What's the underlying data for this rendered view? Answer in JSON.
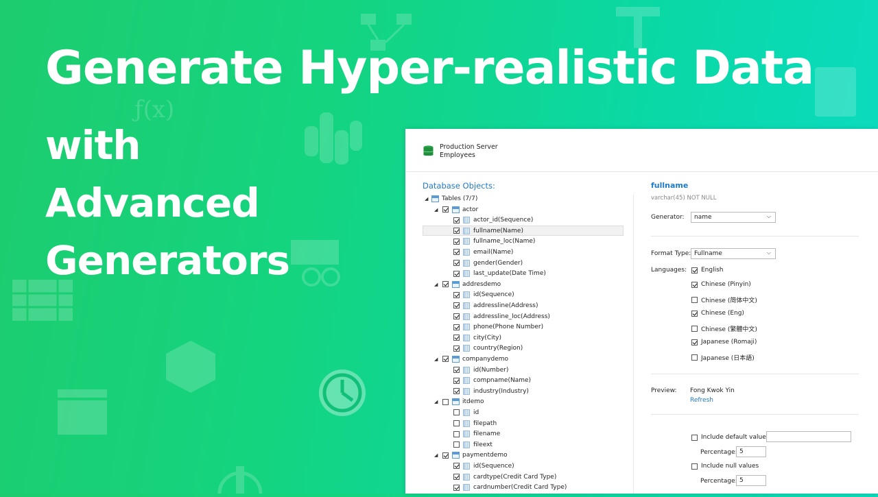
{
  "headline": {
    "line1": "Generate Hyper-realistic Data",
    "line2": "with",
    "line3": "Advanced",
    "line4": "Generators"
  },
  "server": {
    "name": "Production Server",
    "database": "Employees"
  },
  "objects": {
    "title": "Database Objects:",
    "root": "Tables (7/7)",
    "rows": [
      {
        "kind": "table",
        "label": "actor",
        "checked": true
      },
      {
        "kind": "col",
        "label": "actor_id(Sequence)",
        "checked": true
      },
      {
        "kind": "col",
        "label": "fullname(Name)",
        "checked": true,
        "selected": true
      },
      {
        "kind": "col",
        "label": "fullname_loc(Name)",
        "checked": true
      },
      {
        "kind": "col",
        "label": "email(Name)",
        "checked": true
      },
      {
        "kind": "col",
        "label": "gender(Gender)",
        "checked": true
      },
      {
        "kind": "col",
        "label": "last_update(Date Time)",
        "checked": true
      },
      {
        "kind": "table",
        "label": "addresdemo",
        "checked": true
      },
      {
        "kind": "col",
        "label": "id(Sequence)",
        "checked": true
      },
      {
        "kind": "col",
        "label": "addressline(Address)",
        "checked": true
      },
      {
        "kind": "col",
        "label": "addressline_loc(Address)",
        "checked": true
      },
      {
        "kind": "col",
        "label": "phone(Phone Number)",
        "checked": true
      },
      {
        "kind": "col",
        "label": "city(City)",
        "checked": true
      },
      {
        "kind": "col",
        "label": "country(Region)",
        "checked": true
      },
      {
        "kind": "table",
        "label": "companydemo",
        "checked": true
      },
      {
        "kind": "col",
        "label": "id(Number)",
        "checked": true
      },
      {
        "kind": "col",
        "label": "compname(Name)",
        "checked": true
      },
      {
        "kind": "col",
        "label": "industry(Industry)",
        "checked": true
      },
      {
        "kind": "table",
        "label": "itdemo",
        "checked": false
      },
      {
        "kind": "col",
        "label": "id",
        "checked": false
      },
      {
        "kind": "col",
        "label": "filepath",
        "checked": false
      },
      {
        "kind": "col",
        "label": "filename",
        "checked": false
      },
      {
        "kind": "col",
        "label": "fileext",
        "checked": false
      },
      {
        "kind": "table",
        "label": "paymentdemo",
        "checked": true
      },
      {
        "kind": "col",
        "label": "id(Sequence)",
        "checked": true
      },
      {
        "kind": "col",
        "label": "cardtype(Credit Card Type)",
        "checked": true
      },
      {
        "kind": "col",
        "label": "cardnumber(Credit Card Type)",
        "checked": true
      }
    ]
  },
  "field": {
    "name": "fullname",
    "type": "varchar(45) NOT NULL",
    "generator_label": "Generator:",
    "generator_value": "name",
    "format_label": "Format Type:",
    "format_value": "Fullname",
    "languages_label": "Languages:",
    "languages": [
      {
        "label": "English",
        "checked": true
      },
      {
        "label": "Chinese (Pinyin)",
        "checked": true
      },
      {
        "label": "Chinese (简体中文)",
        "checked": false
      },
      {
        "label": "Chinese (Eng)",
        "checked": true
      },
      {
        "label": "Chinese (繁體中文)",
        "checked": false
      },
      {
        "label": "Japanese (Romaji)",
        "checked": true
      },
      {
        "label": "Japanese (日本語)",
        "checked": false
      }
    ],
    "preview_label": "Preview:",
    "preview_value": "Fong Kwok Yin",
    "refresh": "Refresh",
    "include_default": "Include default values",
    "include_default_value": "",
    "percentage_label": "Percentage:",
    "default_percentage": "5",
    "include_null": "Include null values",
    "null_percentage": "5"
  },
  "colors": {
    "accent": "#1f7ac9",
    "bg_start": "#1dcc6e",
    "bg_end": "#0bdcc4"
  }
}
